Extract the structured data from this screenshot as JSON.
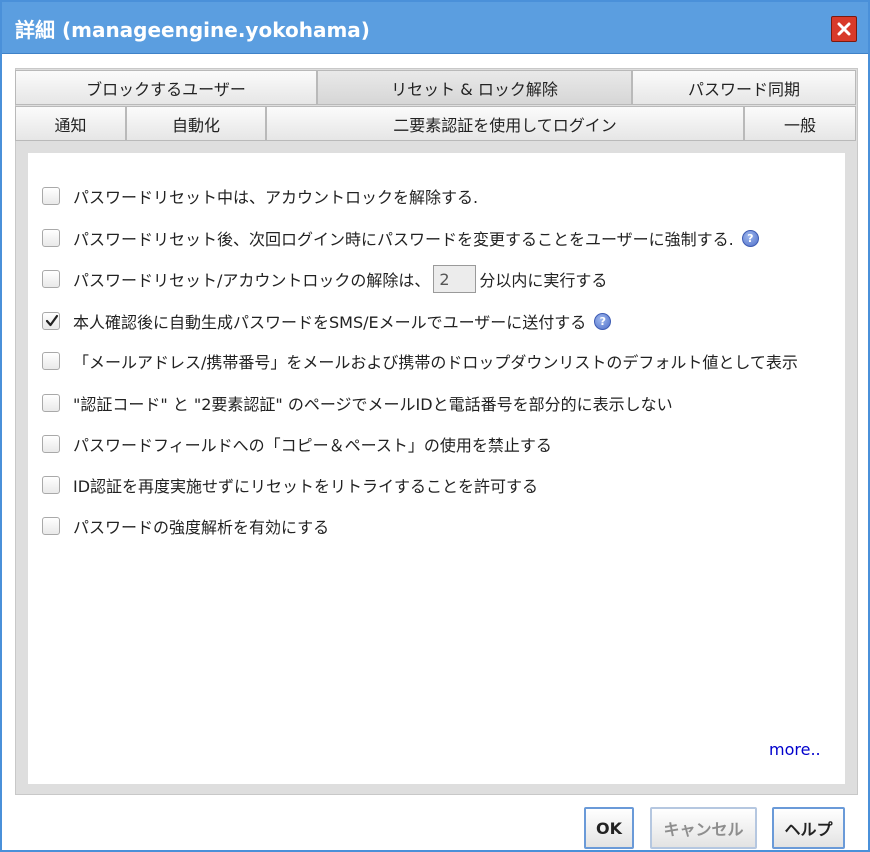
{
  "window": {
    "title": "詳細 (manageengine.yokohama)",
    "accent_color": "#5b9ee0",
    "close_icon": "close-icon"
  },
  "tabs": {
    "row1": [
      {
        "label": "ブロックするユーザー",
        "active": false
      },
      {
        "label": "リセット & ロック解除",
        "active": true
      },
      {
        "label": "パスワード同期",
        "active": false
      }
    ],
    "row2": [
      {
        "label": "通知",
        "active": false
      },
      {
        "label": "自動化",
        "active": false
      },
      {
        "label": "二要素認証を使用してログイン",
        "active": false
      },
      {
        "label": "一般",
        "active": false
      }
    ]
  },
  "options": [
    {
      "label": "パスワードリセット中は、アカウントロックを解除する.",
      "checked": false
    },
    {
      "label": "パスワードリセット後、次回ログイン時にパスワードを変更することをユーザーに強制する.",
      "checked": false,
      "help": true
    },
    {
      "label_before": "パスワードリセット/アカウントロックの解除は、",
      "input_value": "2",
      "label_after": "分以内に実行する",
      "checked": false
    },
    {
      "label": "本人確認後に自動生成パスワードをSMS/Eメールでユーザーに送付する",
      "checked": true,
      "help": true
    },
    {
      "label": "「メールアドレス/携帯番号」をメールおよび携帯のドロップダウンリストのデフォルト値として表示",
      "checked": false
    },
    {
      "label": "\"認証コード\" と \"2要素認証\" のページでメールIDと電話番号を部分的に表示しない",
      "checked": false
    },
    {
      "label": "パスワードフィールドへの「コピー＆ペースト」の使用を禁止する",
      "checked": false
    },
    {
      "label": "ID認証を再度実施せずにリセットをリトライすることを許可する",
      "checked": false
    },
    {
      "label": "パスワードの強度解析を有効にする",
      "checked": false
    }
  ],
  "help_icon_glyph": "?",
  "more_link": "more..",
  "buttons": {
    "ok": "OK",
    "cancel": "キャンセル",
    "help": "ヘルプ"
  }
}
